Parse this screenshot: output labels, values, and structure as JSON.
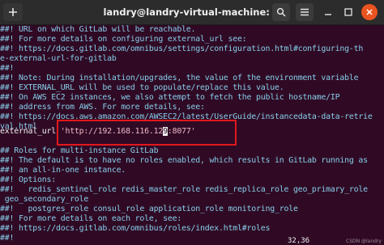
{
  "window": {
    "title": "landry@landry-virtual-machine: ~"
  },
  "icons": {
    "new_tab": "new-tab-icon",
    "search": "search-icon",
    "menu": "hamburger-menu-icon",
    "minimize": "minimize-icon",
    "maximize": "maximize-icon",
    "close": "close-icon"
  },
  "colors": {
    "terminal_bg": "#300a24",
    "comment_text": "#87ceeb",
    "string_text": "#f0b8c8",
    "highlight_box": "#e0181c",
    "close_button": "#e95420"
  },
  "terminal": {
    "lines": [
      "##! URL on which GitLab will be reachable.",
      "##! For more details on configuring external_url see:",
      "##! https://docs.gitlab.com/omnibus/settings/configuration.html#configuring-th",
      "e-external-url-for-gitlab",
      "##!",
      "##! Note: During installation/upgrades, the value of the environment variable",
      "##! EXTERNAL_URL will be used to populate/replace this value.",
      "##! On AWS EC2 instances, we also attempt to fetch the public hostname/IP",
      "##! address from AWS. For more details, see:",
      "##! https://docs.aws.amazon.com/AWSEC2/latest/UserGuide/instancedata-data-retrie",
      "val.html"
    ],
    "external_url_key": "external_url",
    "external_url_before_cursor": "'http://192.168.116.12",
    "cursor_char": "9",
    "external_url_after_cursor": ":8077'",
    "lines_after": [
      "",
      "## Roles for multi-instance GitLab",
      "##! The default is to have no roles enabled, which results in GitLab running as",
      "##! an all-in-one instance.",
      "##! Options:",
      "##!   redis_sentinel_role redis_master_role redis_replica_role geo_primary_role",
      " geo_secondary_role",
      "##!   postgres_role consul_role application_role monitoring_role",
      "##! For more details on each role, see:",
      "##! https://docs.gitlab.com/omnibus/roles/index.html#roles",
      "##!"
    ],
    "cursor_position": "32,36",
    "watermark": "CSDN @landry"
  }
}
